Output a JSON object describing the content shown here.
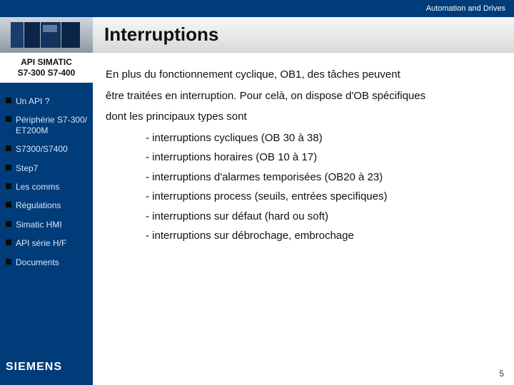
{
  "topbar": {
    "brand_tag": "Automation and Drives"
  },
  "header": {
    "title": "Interruptions"
  },
  "sidebar": {
    "title_line1": "API SIMATIC",
    "title_line2": "S7-300  S7-400",
    "items": [
      {
        "label": "Un API ?"
      },
      {
        "label": "Périphérie S7-300/ ET200M"
      },
      {
        "label": "S7300/S7400"
      },
      {
        "label": "Step7"
      },
      {
        "label": "Les comms"
      },
      {
        "label": "Régulations"
      },
      {
        "label": "Simatic HMI"
      },
      {
        "label": "API série H/F"
      },
      {
        "label": "Documents"
      }
    ],
    "logo": "SIEMENS"
  },
  "content": {
    "p1": "En plus du fonctionnement cyclique, OB1, des tâches peuvent",
    "p2": "être traitées en interruption. Pour celà, on dispose d'OB spécifiques",
    "p3": "dont les principaux types sont",
    "bullets": [
      "- interruptions cycliques (OB 30 à 38)",
      "- interruptions horaires (OB 10 à 17)",
      "- interruptions d'alarmes temporisées (OB20 à 23)",
      "- interruptions process (seuils, entrées specifiques)",
      "- interruptions sur défaut (hard ou soft)",
      "- interruptions sur débrochage, embrochage"
    ]
  },
  "page_number": "5"
}
